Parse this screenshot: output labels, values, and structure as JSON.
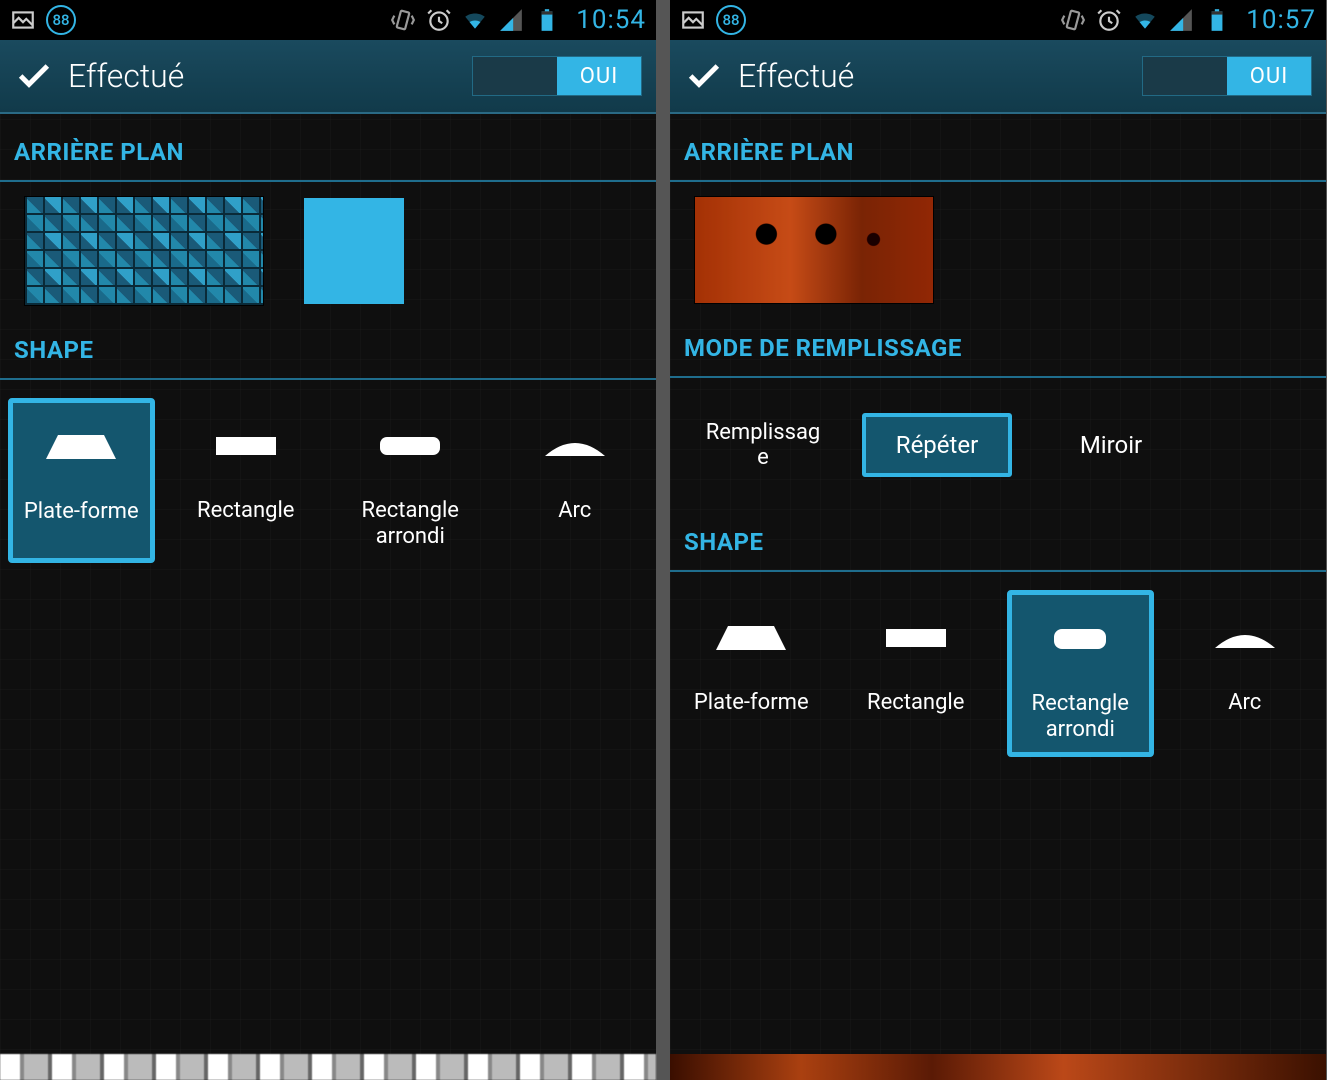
{
  "left": {
    "status": {
      "battery_pct": "88",
      "time": "10:54"
    },
    "action": {
      "title": "Effectué",
      "toggle_on": "OUI"
    },
    "sections": {
      "background_header": "ARRIÈRE PLAN",
      "shape_header": "SHAPE"
    },
    "shapes": [
      {
        "label": "Plate-forme",
        "selected": true
      },
      {
        "label": "Rectangle",
        "selected": false
      },
      {
        "label": "Rectangle arrondi",
        "selected": false
      },
      {
        "label": "Arc",
        "selected": false
      }
    ]
  },
  "right": {
    "status": {
      "battery_pct": "88",
      "time": "10:57"
    },
    "action": {
      "title": "Effectué",
      "toggle_on": "OUI"
    },
    "sections": {
      "background_header": "ARRIÈRE PLAN",
      "fillmode_header": "MODE DE REMPLISSAGE",
      "shape_header": "SHAPE"
    },
    "fill_modes": [
      {
        "label": "Remplissage",
        "selected": false
      },
      {
        "label": "Répéter",
        "selected": true
      },
      {
        "label": "Miroir",
        "selected": false
      }
    ],
    "shapes": [
      {
        "label": "Plate-forme",
        "selected": false
      },
      {
        "label": "Rectangle",
        "selected": false
      },
      {
        "label": "Rectangle arrondi",
        "selected": true
      },
      {
        "label": "Arc",
        "selected": false
      }
    ]
  }
}
